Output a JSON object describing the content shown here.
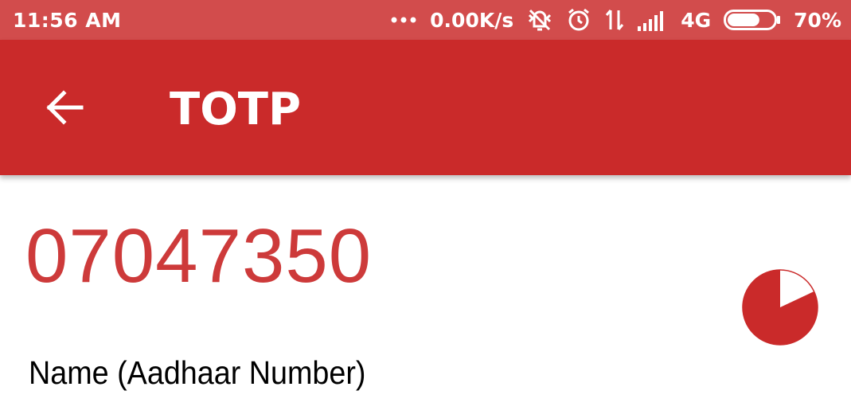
{
  "status_bar": {
    "time": "11:56 AM",
    "notifications_icon": "more-dots-icon",
    "network_speed": "0.00K/s",
    "mute_icon": "vibrate-off-icon",
    "alarm_icon": "alarm-clock-icon",
    "data_icon": "data-transfer-icon",
    "signal_icon": "signal-bars-icon",
    "network_type": "4G",
    "battery_icon": "battery-icon",
    "battery_level": 70,
    "battery_text": "70%"
  },
  "app_bar": {
    "back_icon": "arrow-back-icon",
    "title": "TOTP",
    "color": "#ca2a2a"
  },
  "otp": {
    "code": "07047350",
    "account": "Name (Aadhaar Number)",
    "code_color": "#cd3a3a",
    "timer_remaining_fraction": 0.82
  }
}
